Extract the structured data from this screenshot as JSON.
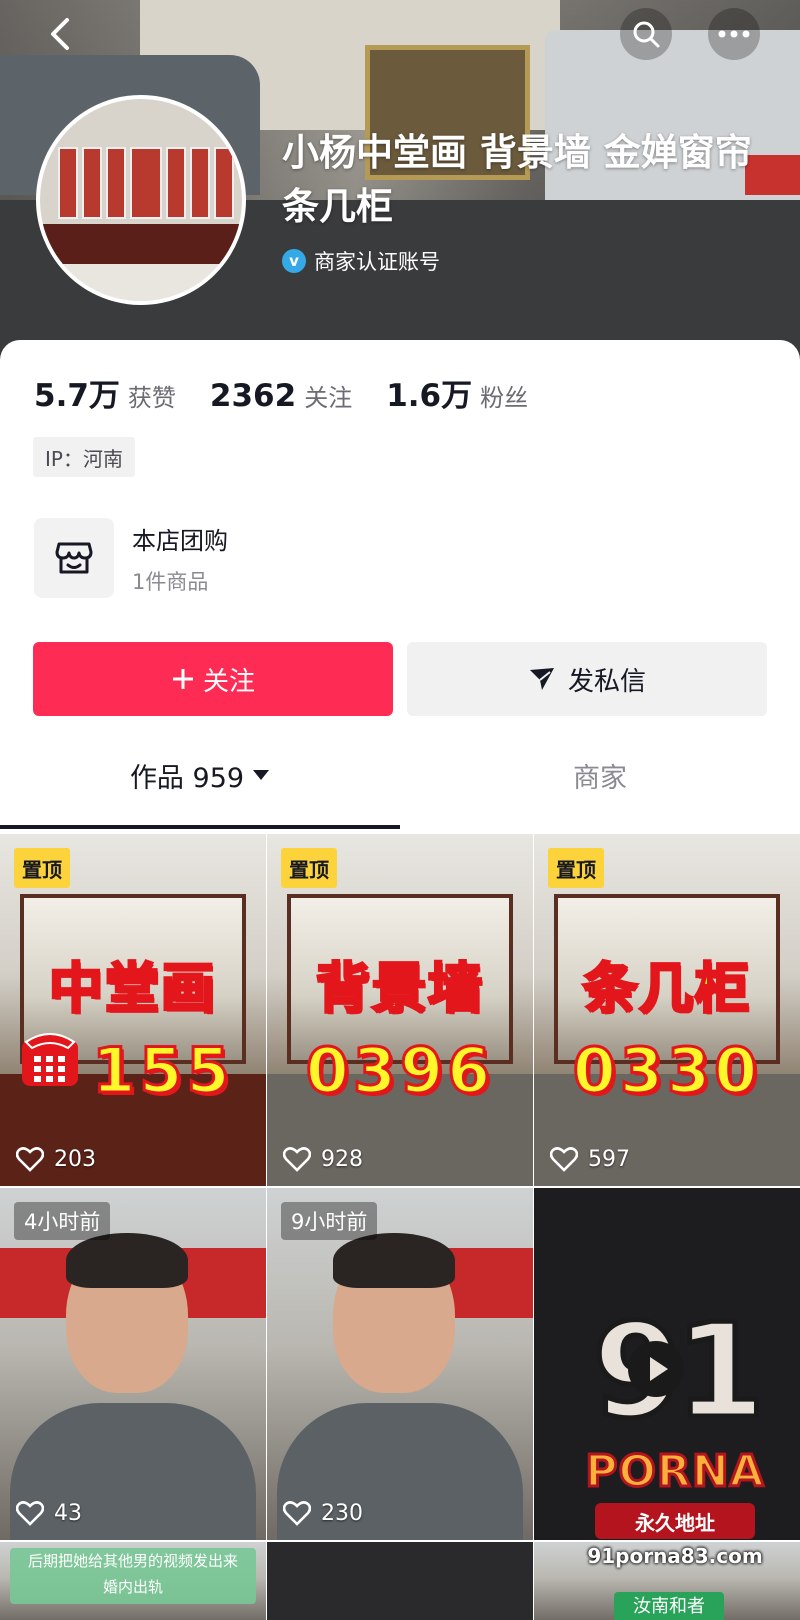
{
  "header": {
    "shop_name": "小杨中堂画 背景墙 金婵窗帘 条几柜",
    "verified_label": "商家认证账号"
  },
  "stats": {
    "likes_value": "5.7万",
    "likes_label": "获赞",
    "following_value": "2362",
    "following_label": "关注",
    "followers_value": "1.6万",
    "followers_label": "粉丝"
  },
  "ip_location": "IP：河南",
  "group_buy": {
    "title": "本店团购",
    "subtitle": "1件商品"
  },
  "actions": {
    "follow_label": "关注",
    "message_label": "发私信"
  },
  "tabs": {
    "works_label": "作品 959",
    "merchant_label": "商家"
  },
  "videos": [
    {
      "pin_label": "置顶",
      "overlay_title": "中堂画",
      "overlay_number": "155",
      "likes": "203"
    },
    {
      "pin_label": "置顶",
      "overlay_title": "背景墙",
      "overlay_number": "0396",
      "likes": "928"
    },
    {
      "pin_label": "置顶",
      "overlay_title": "条几柜",
      "overlay_number": "0330",
      "likes": "597"
    },
    {
      "time_label": "4小时前",
      "likes": "43"
    },
    {
      "time_label": "9小时前",
      "likes": "230"
    }
  ],
  "row3": {
    "caption_first": "后期把她给其他男的视频发出来",
    "caption_second": "婚内出轨",
    "caption_third": "汝南和者"
  },
  "watermark": {
    "logo_number": "91",
    "logo_word": "PORNA",
    "subtitle": "永久地址",
    "url": "91porna83.com"
  },
  "colors": {
    "accent": "#fe2c55",
    "pin_bg": "#fcd33a",
    "verified": "#35a9e8"
  },
  "icons": [
    "back-arrow-icon",
    "search-icon",
    "more-icon",
    "verified-icon",
    "store-icon",
    "plus-icon",
    "send-icon",
    "caret-down-icon",
    "heart-icon",
    "phone-icon",
    "play-icon"
  ]
}
